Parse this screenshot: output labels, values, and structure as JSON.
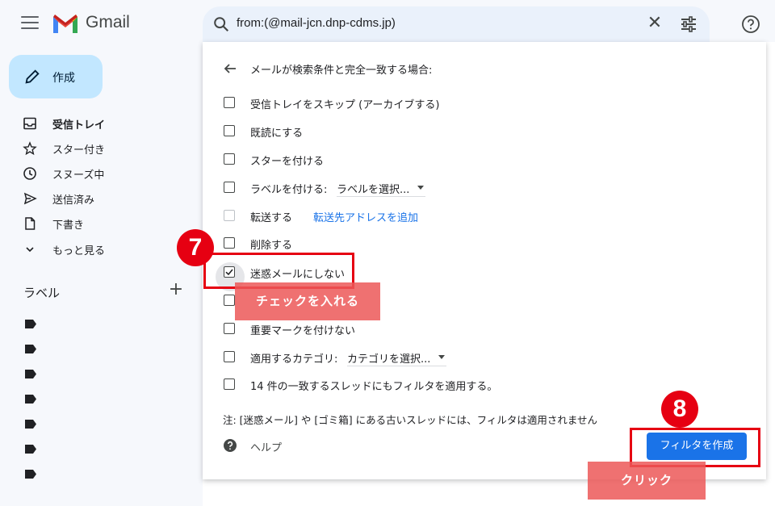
{
  "app": {
    "brand": "Gmail"
  },
  "search": {
    "query": "from:(@mail-jcn.dnp-cdms.jp)"
  },
  "sidebar": {
    "compose_label": "作成",
    "items": [
      {
        "label": "受信トレイ",
        "icon": "inbox-icon"
      },
      {
        "label": "スター付き",
        "icon": "star-icon"
      },
      {
        "label": "スヌーズ中",
        "icon": "clock-icon"
      },
      {
        "label": "送信済み",
        "icon": "send-icon"
      },
      {
        "label": "下書き",
        "icon": "draft-icon"
      },
      {
        "label": "もっと見る",
        "icon": "chevron-down-icon"
      }
    ],
    "labels_heading": "ラベル"
  },
  "filter": {
    "title": "メールが検索条件と完全一致する場合:",
    "options": [
      {
        "label": "受信トレイをスキップ (アーカイブする)",
        "checked": false
      },
      {
        "label": "既読にする",
        "checked": false
      },
      {
        "label": "スターを付ける",
        "checked": false
      },
      {
        "label": "ラベルを付ける:",
        "checked": false,
        "select": "ラベルを選択..."
      },
      {
        "label": "転送する",
        "checked": false,
        "link": "転送先アドレスを追加"
      },
      {
        "label": "削除する",
        "checked": false
      },
      {
        "label": "迷惑メールにしない",
        "checked": true
      },
      {
        "label": "",
        "checked": false
      },
      {
        "label": "重要マークを付けない",
        "checked": false
      },
      {
        "label": "適用するカテゴリ:",
        "checked": false,
        "select": "カテゴリを選択..."
      },
      {
        "label": "14 件の一致するスレッドにもフィルタを適用する。",
        "checked": false
      }
    ],
    "note": "注: [迷惑メール] や [ゴミ箱] にある古いスレッドには、フィルタは適用されません",
    "help": "ヘルプ",
    "create_button": "フィルタを作成"
  },
  "annotations": {
    "step7": "7",
    "step8": "8",
    "callout_check": "チェックを入れる",
    "callout_click": "クリック"
  },
  "colors": {
    "accent": "#1a73e8",
    "annotation": "#e60012",
    "compose": "#c2e7ff"
  }
}
